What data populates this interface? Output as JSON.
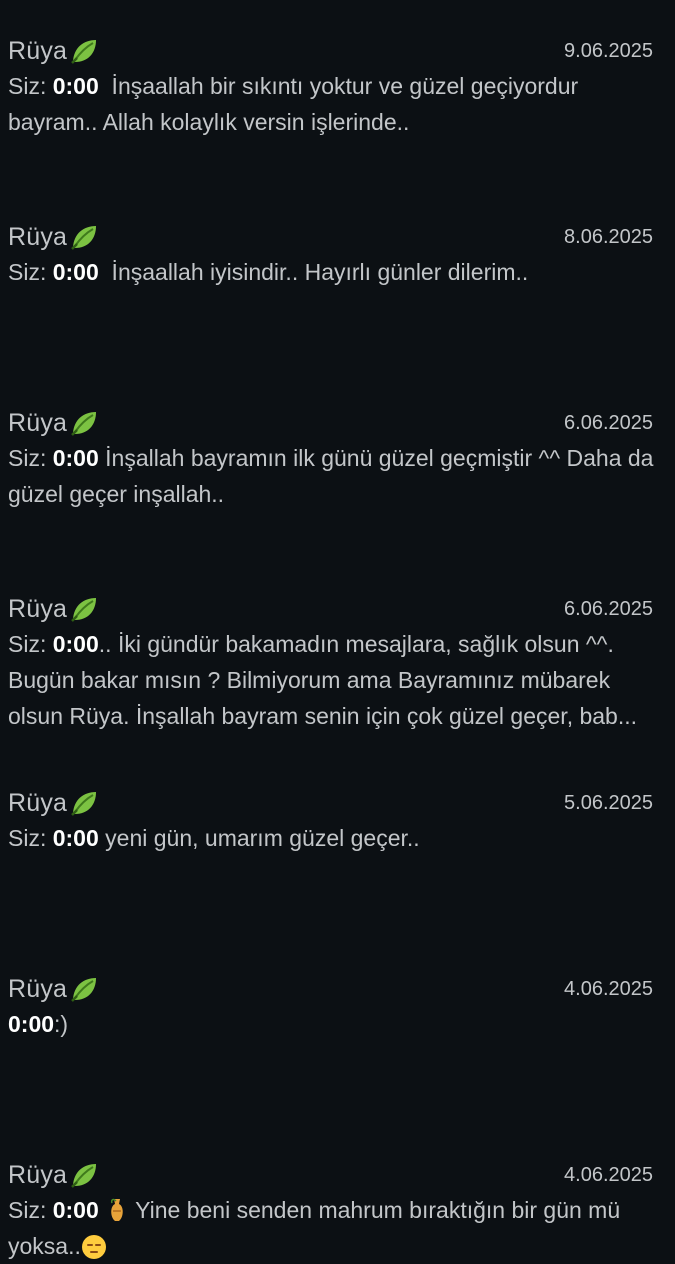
{
  "colors": {
    "background": "#0c1014",
    "text": "#c3c6c9",
    "highlight": "#ffffff",
    "leaf_green": "#7cc242"
  },
  "contact_icon": "leaf-emoji",
  "conversations": [
    {
      "name": "Rüya",
      "date": "9.06.2025",
      "prefix": "Siz: ",
      "time": "0:00",
      "text": "  İnşaallah bir sıkıntı yoktur ve güzel geçiyordur bayram.. Allah kolaylık versin işlerinde..",
      "trailing_emoji": ""
    },
    {
      "name": "Rüya",
      "date": "8.06.2025",
      "prefix": "Siz: ",
      "time": "0:00",
      "text": "  İnşaallah iyisindir.. Hayırlı günler dilerim..",
      "trailing_emoji": ""
    },
    {
      "name": "Rüya",
      "date": "6.06.2025",
      "prefix": "Siz: ",
      "time": "0:00",
      "text": " İnşallah bayramın ilk günü güzel geçmiştir ^^ Daha da güzel geçer inşallah..",
      "trailing_emoji": ""
    },
    {
      "name": "Rüya",
      "date": "6.06.2025",
      "prefix": "Siz: ",
      "time": "0:00",
      "text": ".. İki gündür bakamadın mesajlara, sağlık olsun ^^. Bugün bakar mısın ? Bilmiyorum ama Bayramınız mübarek olsun Rüya. İnşallah bayram senin için çok güzel geçer, bab...",
      "trailing_emoji": ""
    },
    {
      "name": "Rüya",
      "date": "5.06.2025",
      "prefix": "Siz: ",
      "time": "0:00",
      "text": " yeni gün, umarım güzel geçer..",
      "trailing_emoji": ""
    },
    {
      "name": "Rüya",
      "date": "4.06.2025",
      "prefix": "",
      "time": "0:00",
      "text": ":)",
      "trailing_emoji": ""
    },
    {
      "name": "Rüya",
      "date": "4.06.2025",
      "prefix": "Siz: ",
      "time": "0:00",
      "text": " Yine beni senden mahrum bıraktığın bir gün mü yoksa..",
      "leading_emoji": "vase-emoji",
      "trailing_emoji": "pensive-face-emoji"
    }
  ]
}
